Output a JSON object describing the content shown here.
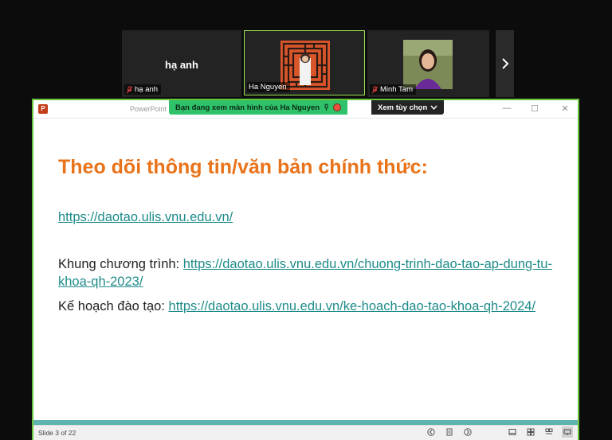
{
  "participants": [
    {
      "center_name": "hạ anh",
      "label": "hạ anh",
      "muted": true
    },
    {
      "label": "Ha Nguyen",
      "muted": false
    },
    {
      "label": "Minh Tam",
      "muted": true
    }
  ],
  "next_icon": "chevron-right-icon",
  "window": {
    "app_title": "PowerPoint",
    "share_banner": "Bạn đang xem màn hình của  Ha Nguyen",
    "view_options": "Xem tùy chọn",
    "controls": {
      "minimize": "—",
      "maximize": "☐",
      "close": "✕"
    }
  },
  "slide": {
    "title": "Theo dõi thông tin/văn bản chính thức:",
    "link_main": "https://daotao.ulis.vnu.edu.vn/",
    "curriculum_label": "Khung chương trình: ",
    "curriculum_link": "https://daotao.ulis.vnu.edu.vn/chuong-trinh-dao-tao-ap-dung-tu-khoa-qh-2023/",
    "plan_label": "Kế hoạch đào tạo: ",
    "plan_link": "https://daotao.ulis.vnu.edu.vn/ke-hoach-dao-tao-khoa-qh-2024/"
  },
  "status": {
    "slide_count": "Slide 3 of 22"
  },
  "colors": {
    "accent_border": "#68c43c",
    "banner": "#2fc26b",
    "title_orange": "#e8731a",
    "link_teal": "#1e8b8a"
  }
}
